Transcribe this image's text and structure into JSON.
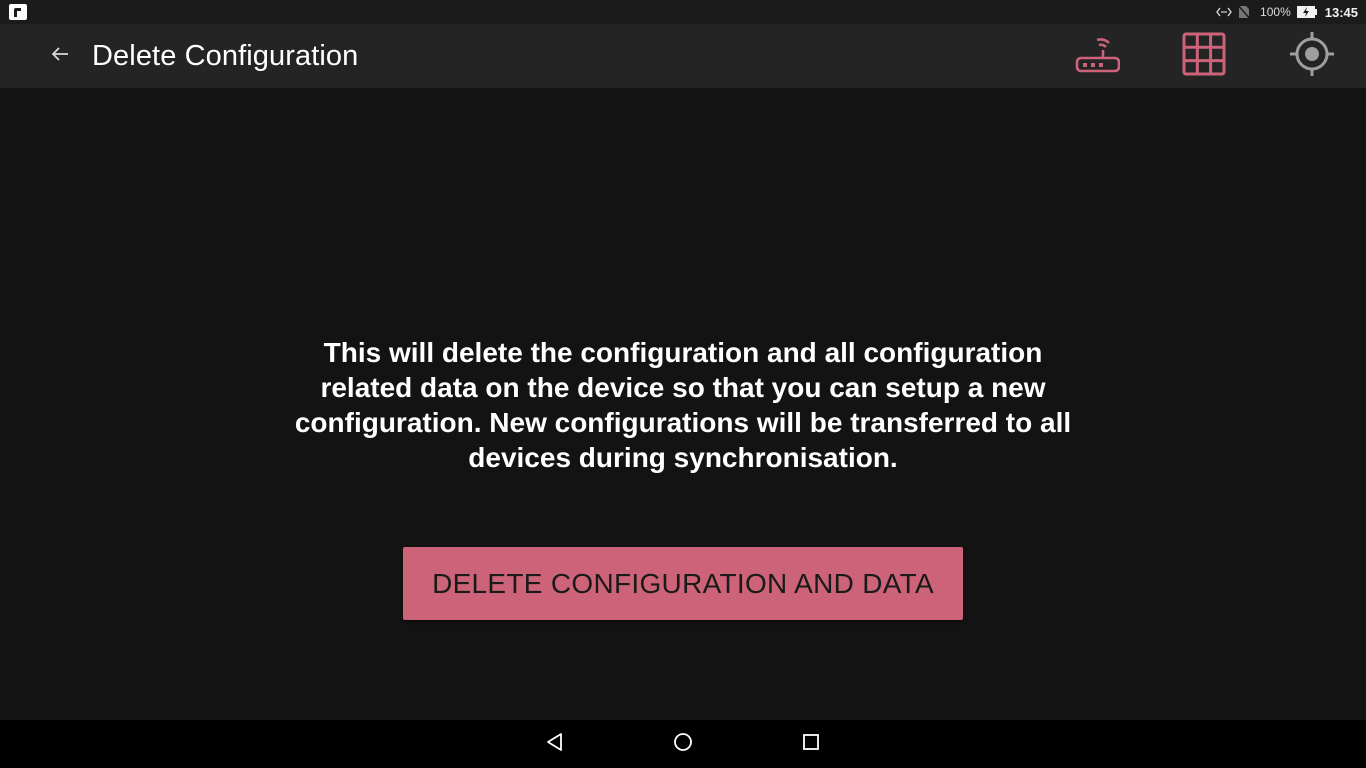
{
  "status_bar": {
    "battery_percent": "100%",
    "time": "13:45",
    "icons": [
      "notification-app-icon",
      "data-sync-icon",
      "no-sim-icon",
      "battery-charging-icon"
    ]
  },
  "app_bar": {
    "title": "Delete Configuration",
    "back_icon": "arrow-back-icon",
    "actions": [
      "router-wifi-icon",
      "grid-icon",
      "gps-target-icon"
    ],
    "accent_color": "#cc6379",
    "inactive_color": "#9e9e9e"
  },
  "main": {
    "description": "This will delete the configuration and all configuration related data on the device so that you can setup a new configuration. New configurations will be transferred to all devices during synchronisation.",
    "delete_button_label": "DELETE CONFIGURATION AND DATA"
  },
  "nav_bar": {
    "buttons": [
      "nav-back-icon",
      "nav-home-icon",
      "nav-recents-icon"
    ]
  }
}
